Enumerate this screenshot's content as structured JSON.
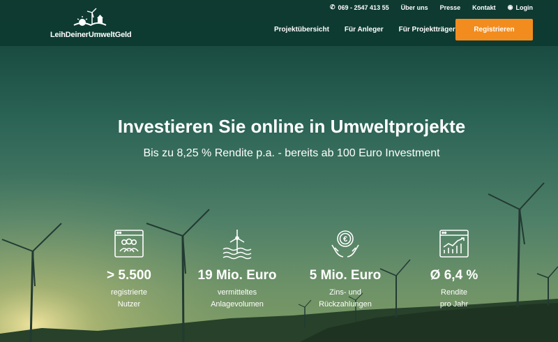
{
  "brand": {
    "name": "LeihDeinerUmweltGeld"
  },
  "utility": {
    "phone": "069 - 2547 413 55",
    "links": [
      "Über uns",
      "Presse",
      "Kontakt"
    ],
    "login": "Login"
  },
  "nav": {
    "items": [
      "Projektübersicht",
      "Für Anleger",
      "Für Projektträger"
    ],
    "register": "Registrieren"
  },
  "hero": {
    "title": "Investieren Sie online in Umweltprojekte",
    "subtitle": "Bis zu 8,25 % Rendite p.a. - bereits ab 100 Euro Investment"
  },
  "stats": [
    {
      "value": "> 5.500",
      "line1": "registrierte",
      "line2": "Nutzer",
      "icon": "users-browser-icon"
    },
    {
      "value": "19 Mio. Euro",
      "line1": "vermitteltes",
      "line2": "Anlagevolumen",
      "icon": "wind-turbine-icon"
    },
    {
      "value": "5 Mio. Euro",
      "line1": "Zins- und",
      "line2": "Rückzahlungen",
      "icon": "euro-coin-hands-icon"
    },
    {
      "value": "Ø 6,4 %",
      "line1": "Rendite",
      "line2": "pro Jahr",
      "icon": "growth-chart-icon"
    }
  ],
  "colors": {
    "header_bg": "#0e3a30",
    "accent": "#f28c1e"
  }
}
